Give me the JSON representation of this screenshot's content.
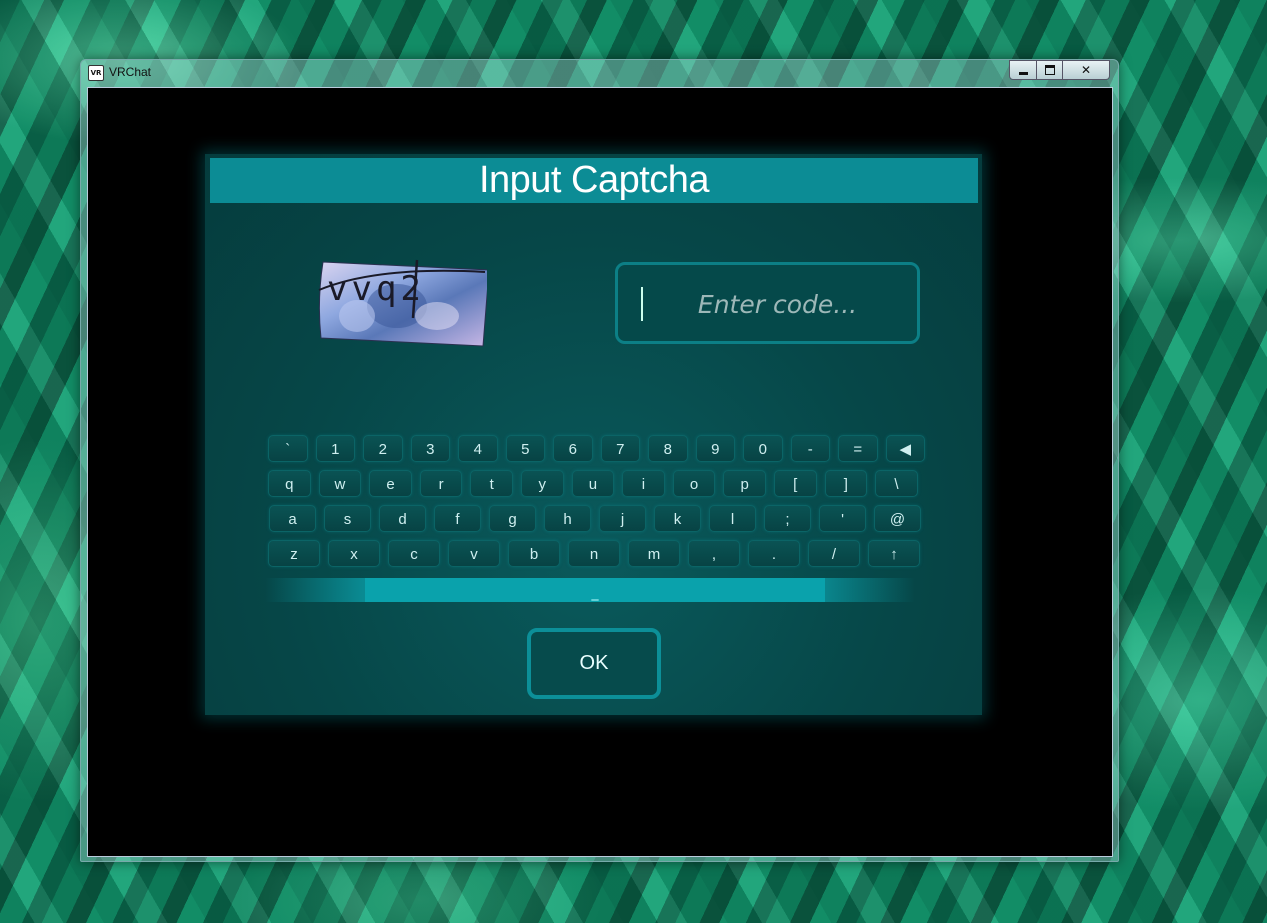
{
  "window": {
    "title": "VRChat",
    "icon_text": "VR",
    "controls": [
      "minimize-icon",
      "maximize-icon",
      "close-icon"
    ],
    "close_glyph": "✕"
  },
  "dialog": {
    "title": "Input Captcha",
    "captcha_text": "vvq2",
    "input_placeholder": "Enter code...",
    "ok_label": "OK",
    "spacebar_label": "_"
  },
  "keyboard": {
    "rows": [
      [
        "`",
        "1",
        "2",
        "3",
        "4",
        "5",
        "6",
        "7",
        "8",
        "9",
        "0",
        "-",
        "=",
        "◀"
      ],
      [
        "q",
        "w",
        "e",
        "r",
        "t",
        "y",
        "u",
        "i",
        "o",
        "p",
        "[",
        "]",
        "\\"
      ],
      [
        "a",
        "s",
        "d",
        "f",
        "g",
        "h",
        "j",
        "k",
        "l",
        ";",
        "'",
        "@"
      ],
      [
        "z",
        "x",
        "c",
        "v",
        "b",
        "n",
        "m",
        ",",
        ".",
        "/",
        "↑"
      ]
    ]
  },
  "colors": {
    "panel_header": "#0c8c95",
    "panel_bg": "#064748",
    "accent": "#0aa2ac"
  }
}
